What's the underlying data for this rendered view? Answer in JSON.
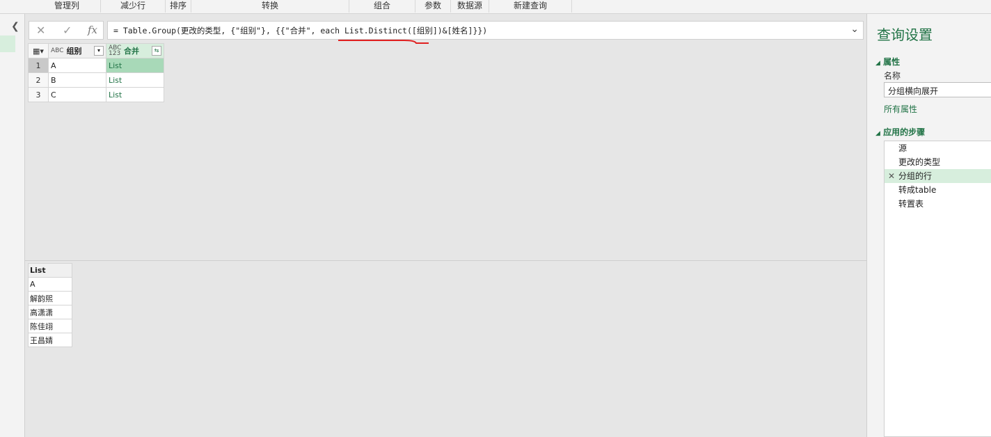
{
  "ribbon": {
    "groups": [
      "管理列",
      "减少行",
      "排序",
      "转换",
      "组合",
      "参数",
      "数据源",
      "新建查询"
    ]
  },
  "formula_bar": {
    "cancel_icon": "✕",
    "commit_icon": "✓",
    "fx_label": "fx",
    "formula": "= Table.Group(更改的类型, {\"组别\"}, {{\"合并\", each List.Distinct([组别])&[姓名]}})",
    "underline_color": "#e02020"
  },
  "grid": {
    "columns": [
      {
        "type": "ABC",
        "name": "组别"
      },
      {
        "type": "ABC 123",
        "name": "合并"
      }
    ],
    "rows": [
      {
        "num": "1",
        "group": "A",
        "merge": "List"
      },
      {
        "num": "2",
        "group": "B",
        "merge": "List"
      },
      {
        "num": "3",
        "group": "C",
        "merge": "List"
      }
    ]
  },
  "preview": {
    "header": "List",
    "items": [
      "A",
      "解韵煕",
      "高潇潇",
      "陈佳翊",
      "王昌婧"
    ]
  },
  "query_settings": {
    "title": "查询设置",
    "properties_label": "属性",
    "name_label": "名称",
    "name_value": "分组横向展开",
    "all_properties": "所有属性",
    "applied_steps_label": "应用的步骤",
    "steps": [
      "源",
      "更改的类型",
      "分组的行",
      "转成table",
      "转置表"
    ],
    "current_step_index": 2
  },
  "colors": {
    "accent": "#217346",
    "selected": "#d7eedd"
  }
}
